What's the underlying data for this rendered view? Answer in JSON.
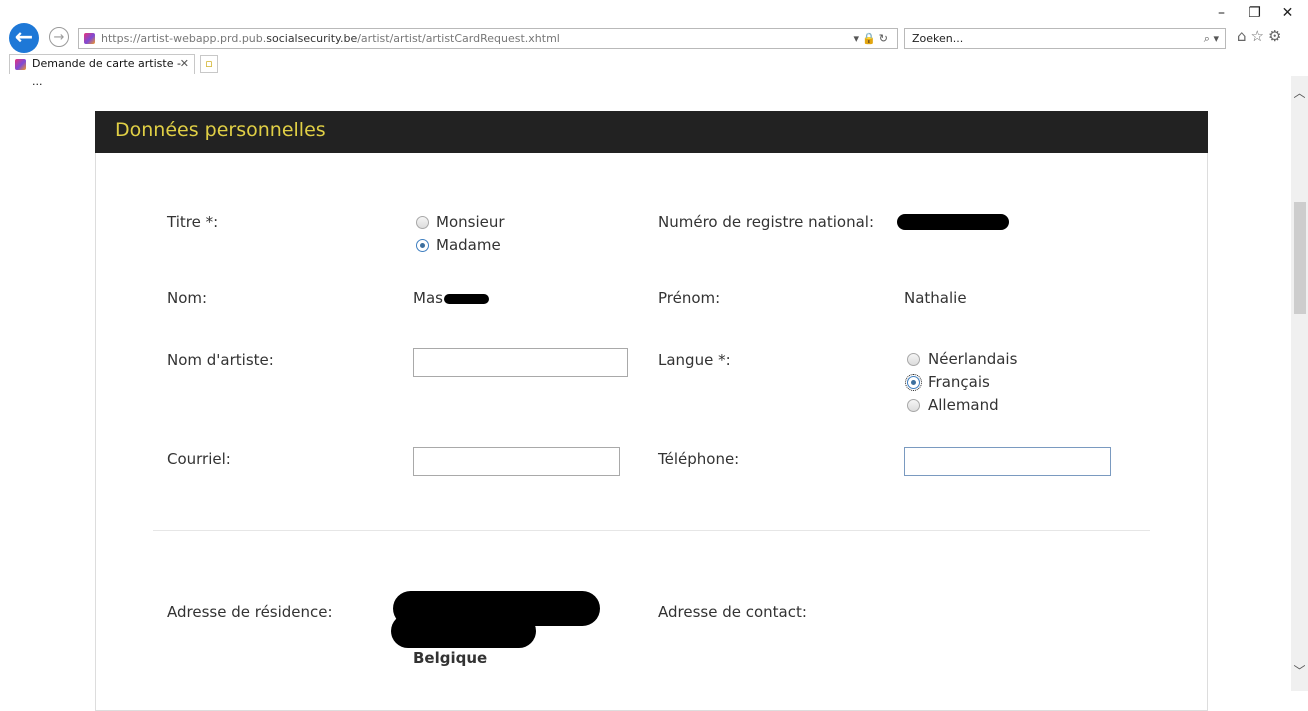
{
  "browser": {
    "url_host_part": "https://artist-webapp.prd.pub.",
    "url_domain": "socialsecurity.be",
    "url_path": "/artist/artist/artistCardRequest.xhtml",
    "search_placeholder": "Zoeken...",
    "tab_title": "Demande de carte artiste - ...",
    "accent": "#1e78d7"
  },
  "section": {
    "title": "Données personnelles",
    "header_bg": "#222222",
    "title_color": "#e0cf45"
  },
  "form": {
    "titre_label": "Titre *:",
    "titre_options": [
      "Monsieur",
      "Madame"
    ],
    "titre_selected": "Madame",
    "registre_label": "Numéro de registre national:",
    "nom_label": "Nom:",
    "nom_value": "Mas",
    "prenom_label": "Prénom:",
    "prenom_value": "Nathalie",
    "nom_artiste_label": "Nom d'artiste:",
    "nom_artiste_value": "",
    "langue_label": "Langue *:",
    "langue_options": [
      "Néerlandais",
      "Français",
      "Allemand"
    ],
    "langue_selected": "Français",
    "courriel_label": "Courriel:",
    "courriel_value": "",
    "telephone_label": "Téléphone:",
    "telephone_value": "",
    "adresse_residence_label": "Adresse de résidence:",
    "adresse_residence_country": "Belgique",
    "adresse_contact_label": "Adresse de contact:"
  }
}
